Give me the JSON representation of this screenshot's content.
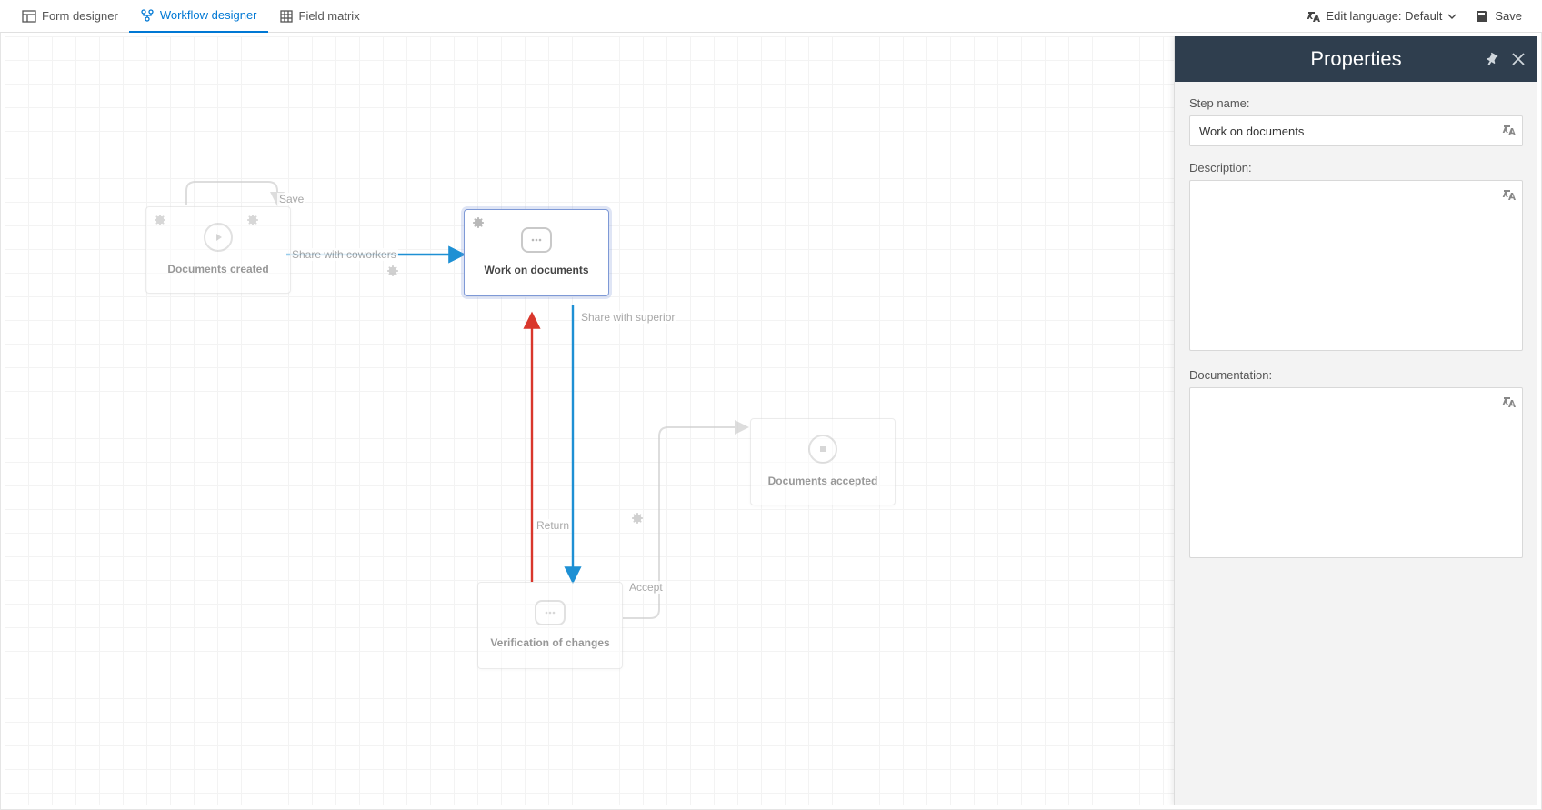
{
  "toolbar": {
    "tabs": [
      {
        "label": "Form designer"
      },
      {
        "label": "Workflow designer"
      },
      {
        "label": "Field matrix"
      }
    ],
    "edit_language_label": "Edit language: Default",
    "save_label": "Save"
  },
  "workflow": {
    "nodes": {
      "documents_created": {
        "title": "Documents created"
      },
      "work_on_documents": {
        "title": "Work on documents"
      },
      "verification_of_changes": {
        "title": "Verification of changes"
      },
      "documents_accepted": {
        "title": "Documents accepted"
      }
    },
    "edges": {
      "save": {
        "label": "Save"
      },
      "share_with_coworkers": {
        "label": "Share with coworkers"
      },
      "share_with_superior": {
        "label": "Share with superior"
      },
      "return": {
        "label": "Return"
      },
      "accept": {
        "label": "Accept"
      }
    }
  },
  "panel": {
    "title": "Properties",
    "step_name_label": "Step name:",
    "step_name_value": "Work on documents",
    "description_label": "Description:",
    "description_value": "",
    "documentation_label": "Documentation:",
    "documentation_value": ""
  }
}
